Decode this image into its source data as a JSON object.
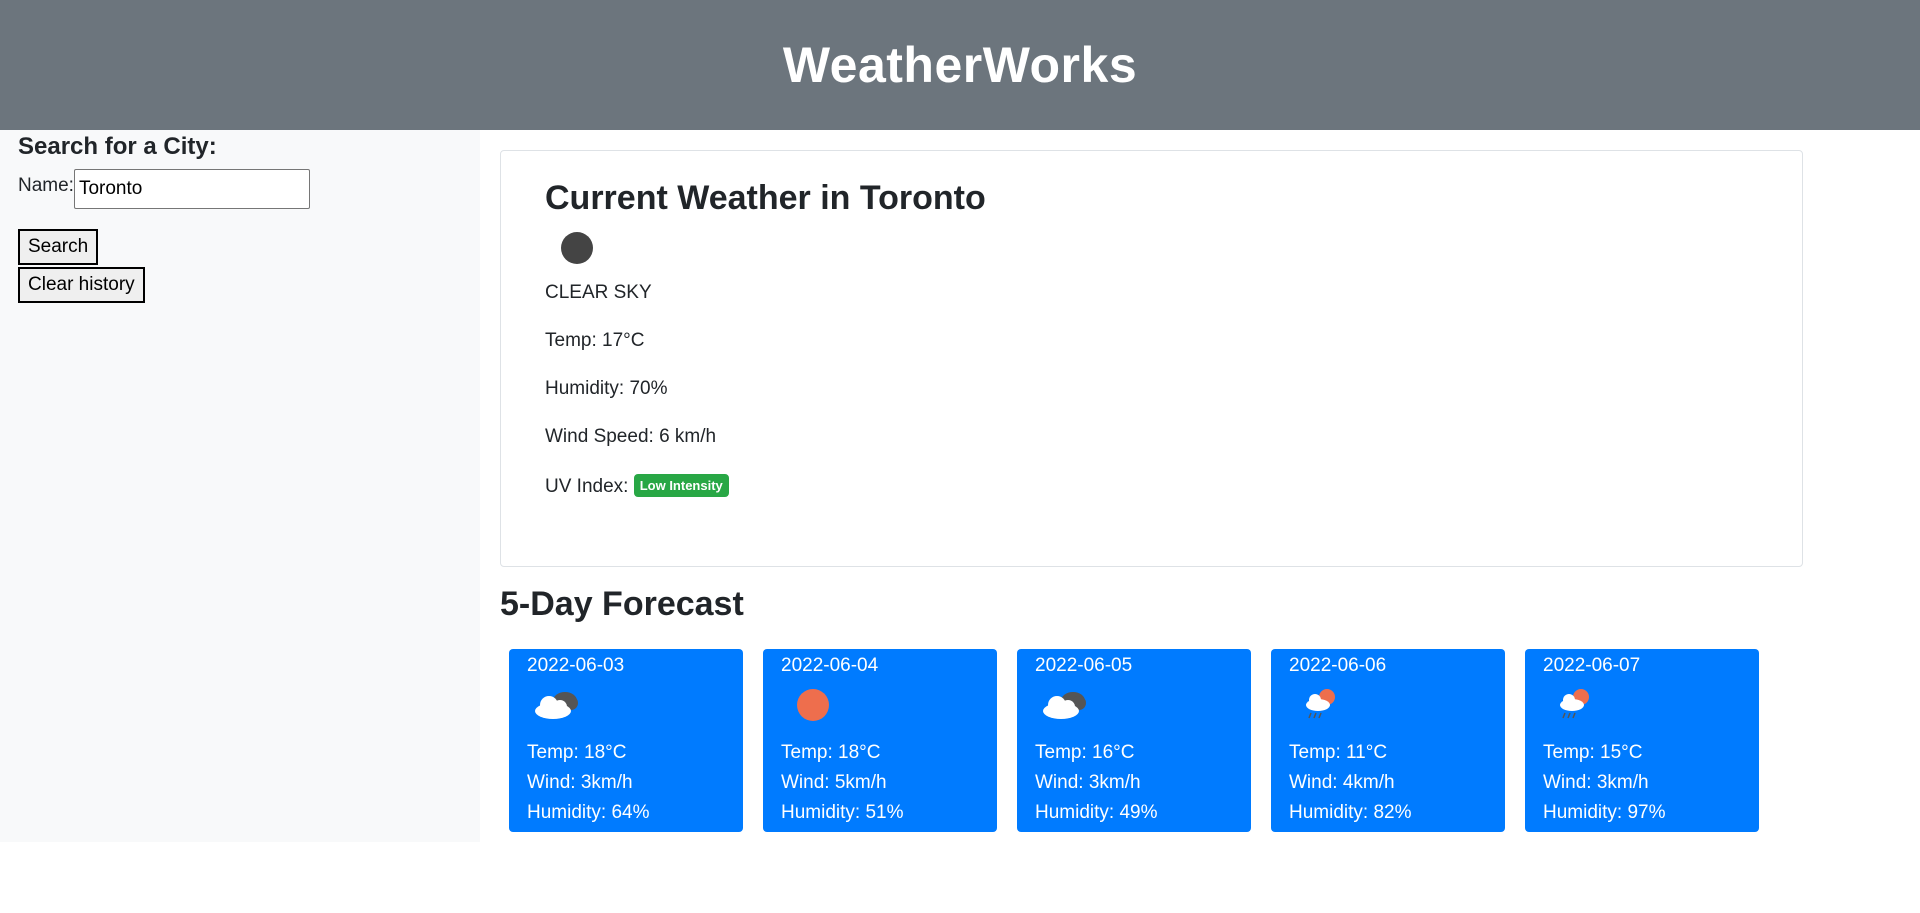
{
  "header": {
    "title": "WeatherWorks"
  },
  "search": {
    "heading": "Search for a City:",
    "name_label": "Name:",
    "input_value": "Toronto",
    "search_button": "Search",
    "clear_button": "Clear history"
  },
  "current": {
    "title": "Current Weather in Toronto",
    "icon": "clear-sky-icon",
    "description": "CLEAR SKY",
    "temp": "Temp: 17°C",
    "humidity": "Humidity: 70%",
    "wind": "Wind Speed: 6 km/h",
    "uv_label": "UV Index:",
    "uv_badge": "Low Intensity",
    "uv_color": "#28a745"
  },
  "forecast": {
    "title": "5-Day Forecast",
    "days": [
      {
        "date": "2022-06-03",
        "icon": "broken-clouds-icon",
        "temp": "Temp: 18°C",
        "wind": "Wind: 3km/h",
        "humidity": "Humidity: 64%"
      },
      {
        "date": "2022-06-04",
        "icon": "clear-sky-icon",
        "temp": "Temp: 18°C",
        "wind": "Wind: 5km/h",
        "humidity": "Humidity: 51%"
      },
      {
        "date": "2022-06-05",
        "icon": "broken-clouds-icon",
        "temp": "Temp: 16°C",
        "wind": "Wind: 3km/h",
        "humidity": "Humidity: 49%"
      },
      {
        "date": "2022-06-06",
        "icon": "rain-sun-icon",
        "temp": "Temp: 11°C",
        "wind": "Wind: 4km/h",
        "humidity": "Humidity: 82%"
      },
      {
        "date": "2022-06-07",
        "icon": "rain-sun-icon",
        "temp": "Temp: 15°C",
        "wind": "Wind: 3km/h",
        "humidity": "Humidity: 97%"
      }
    ],
    "card_color": "#007bff"
  }
}
